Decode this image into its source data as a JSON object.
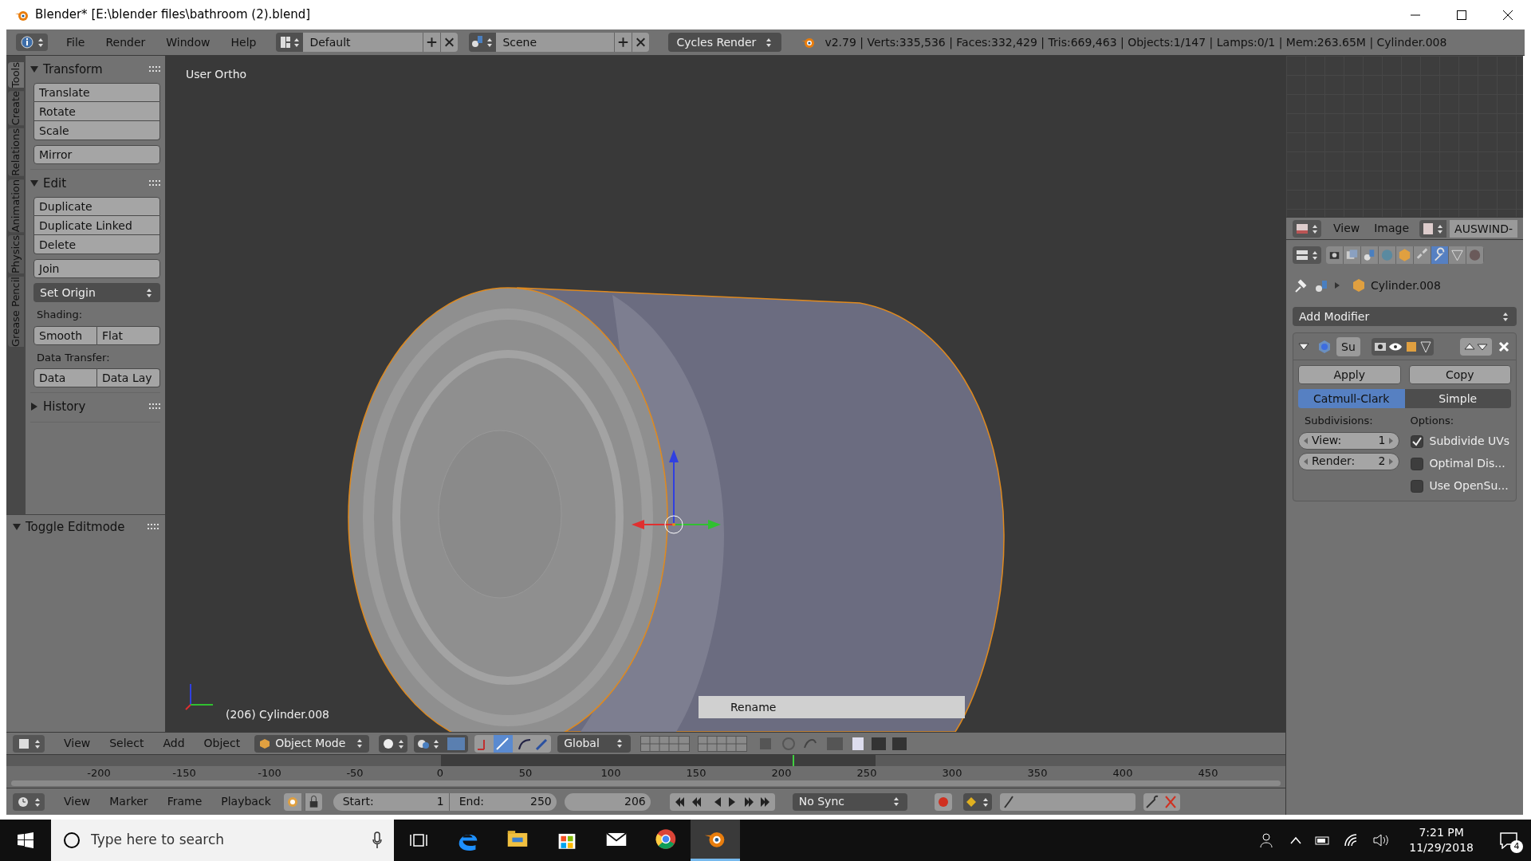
{
  "window": {
    "title": "Blender* [E:\\blender files\\bathroom (2).blend]"
  },
  "info_header": {
    "menus": [
      "File",
      "Render",
      "Window",
      "Help"
    ],
    "layout": "Default",
    "scene": "Scene",
    "engine": "Cycles Render",
    "stats": "v2.79 | Verts:335,536 | Faces:332,429 | Tris:669,463 | Objects:1/147 | Lamps:0/1 | Mem:263.65M | Cylinder.008"
  },
  "tool_tabs": [
    {
      "label": "Tools",
      "selected": true
    },
    {
      "label": "Create",
      "selected": false
    },
    {
      "label": "Relations",
      "selected": false
    },
    {
      "label": "Animation",
      "selected": false
    },
    {
      "label": "Physics",
      "selected": false
    },
    {
      "label": "Grease Pencil",
      "selected": false
    }
  ],
  "tool_panels": [
    {
      "title": "Transform",
      "expanded": true,
      "items": [
        {
          "kind": "stack",
          "labels": [
            "Translate",
            "Rotate",
            "Scale"
          ]
        },
        {
          "kind": "stack",
          "labels": [
            "Mirror"
          ]
        }
      ]
    },
    {
      "title": "Edit",
      "expanded": true,
      "items": [
        {
          "kind": "stack",
          "labels": [
            "Duplicate",
            "Duplicate Linked",
            "Delete"
          ]
        },
        {
          "kind": "stack",
          "labels": [
            "Join"
          ]
        },
        {
          "kind": "dropdown",
          "label": "Set Origin"
        },
        {
          "kind": "label",
          "label": "Shading:"
        },
        {
          "kind": "row",
          "labels": [
            "Smooth",
            "Flat"
          ]
        },
        {
          "kind": "label",
          "label": "Data Transfer:"
        },
        {
          "kind": "row",
          "labels": [
            "Data",
            "Data Lay"
          ]
        }
      ]
    },
    {
      "title": "History",
      "expanded": false
    }
  ],
  "operator_panel": {
    "title": "Toggle Editmode",
    "expanded": true
  },
  "viewport": {
    "view_label": "User Ortho",
    "object_label": "(206) Cylinder.008",
    "popup": "Rename"
  },
  "viewport_header": {
    "menus": [
      "View",
      "Select",
      "Add",
      "Object"
    ],
    "mode": "Object Mode",
    "orientation": "Global"
  },
  "timeline": {
    "ruler_labels": [
      "-200",
      "-150",
      "-100",
      "-50",
      "0",
      "50",
      "100",
      "150",
      "200",
      "250",
      "300",
      "350",
      "400",
      "450"
    ],
    "menus": [
      "View",
      "Marker",
      "Frame",
      "Playback"
    ],
    "start_label": "Start:",
    "start": "1",
    "end_label": "End:",
    "end": "250",
    "current_frame": "206",
    "sync": "No Sync"
  },
  "uv_header": {
    "menus": [
      "View",
      "Image"
    ],
    "image": "AUSWIND-"
  },
  "properties": {
    "tabs": [
      {
        "selected": false
      },
      {
        "selected": false
      },
      {
        "selected": false
      },
      {
        "selected": false
      },
      {
        "selected": false
      },
      {
        "selected": false
      },
      {
        "selected": true
      },
      {
        "selected": false
      },
      {
        "selected": false
      }
    ],
    "object": "Cylinder.008",
    "add_modifier": "Add Modifier",
    "modifier": {
      "name": "Su",
      "expanded": true,
      "apply": "Apply",
      "copy": "Copy",
      "types": [
        {
          "label": "Catmull-Clark",
          "selected": true
        },
        {
          "label": "Simple",
          "selected": false
        }
      ],
      "subdivisions_label": "Subdivisions:",
      "fields": [
        {
          "label": "View:",
          "value": "1"
        },
        {
          "label": "Render:",
          "value": "2"
        }
      ],
      "options_label": "Options:",
      "options": [
        {
          "label": "Subdivide UVs",
          "checked": true
        },
        {
          "label": "Optimal Dis...",
          "checked": false
        },
        {
          "label": "Use OpenSu...",
          "checked": false
        }
      ]
    }
  },
  "taskbar": {
    "search_placeholder": "Type here to search",
    "apps": [
      {
        "selected": false
      },
      {
        "selected": false
      },
      {
        "selected": false
      },
      {
        "selected": false
      },
      {
        "selected": false
      },
      {
        "selected": true
      }
    ],
    "time": "7:21 PM",
    "date": "11/29/2018",
    "notifications": "4"
  }
}
